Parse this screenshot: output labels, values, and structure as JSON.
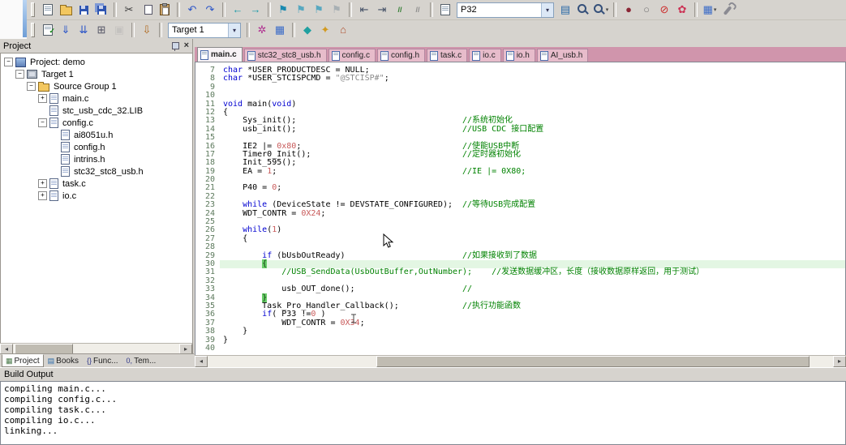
{
  "colors": {
    "keyword": "#0000d0",
    "comment": "#008200",
    "number": "#c85a5a",
    "string": "#8a8a8a",
    "brace_bg": "#6ace6a",
    "row_highlight": "#e3f6e3",
    "tabstrip_bg": "#d095ac",
    "chrome_bg": "#d6d3ce"
  },
  "toolbar1": {
    "items": [
      {
        "name": "new-file-icon",
        "shape": "page"
      },
      {
        "name": "open-file-icon",
        "shape": "folder"
      },
      {
        "name": "save-icon",
        "shape": "floppy"
      },
      {
        "name": "save-all-icon",
        "shape": "floppy-all"
      },
      {
        "sep": true
      },
      {
        "name": "cut-icon",
        "glyph": "✂",
        "color": "#3a3a3a"
      },
      {
        "name": "copy-icon",
        "shape": "copy"
      },
      {
        "name": "paste-icon",
        "shape": "paste"
      },
      {
        "sep": true
      },
      {
        "name": "undo-icon",
        "glyph": "↶",
        "color": "#2b55c8"
      },
      {
        "name": "redo-icon",
        "glyph": "↷",
        "color": "#2b55c8"
      },
      {
        "sep": true
      },
      {
        "name": "navigate-back-icon",
        "glyph": "←",
        "color": "#1a9aa8"
      },
      {
        "name": "navigate-forward-icon",
        "glyph": "→",
        "color": "#1a9aa8"
      },
      {
        "sep": true
      },
      {
        "name": "toggle-bookmark-icon",
        "glyph": "⚑",
        "color": "#1a8ab0"
      },
      {
        "name": "previous-bookmark-icon",
        "glyph": "⚑",
        "color": "#58a8c0"
      },
      {
        "name": "next-bookmark-icon",
        "glyph": "⚑",
        "color": "#58a8c0"
      },
      {
        "name": "clear-bookmarks-icon",
        "glyph": "⚑",
        "color": "#a8b0b4"
      },
      {
        "sep": true
      },
      {
        "name": "indent-left-icon",
        "glyph": "⇤",
        "color": "#445066"
      },
      {
        "name": "indent-right-icon",
        "glyph": "⇥",
        "color": "#445066"
      },
      {
        "name": "comment-icon",
        "glyph": "//",
        "color": "#2a7a2a",
        "small": true
      },
      {
        "name": "uncomment-icon",
        "glyph": "//",
        "color": "#888888",
        "small": true
      },
      {
        "sep": true
      },
      {
        "name": "find-text-icon",
        "shape": "page"
      },
      {
        "type": "combo",
        "name": "find-combobox",
        "text": "P32",
        "width": 118
      },
      {
        "name": "find-in-files-icon",
        "glyph": "▤",
        "color": "#2a6aa8"
      },
      {
        "name": "find-icon",
        "shape": "mag"
      },
      {
        "name": "search-options-icon",
        "shape": "mag",
        "dropdown": true
      },
      {
        "sep": true
      },
      {
        "name": "insert-breakpoint-icon",
        "glyph": "●",
        "color": "#8b2635"
      },
      {
        "name": "enable-disable-breakpoint-icon",
        "glyph": "○",
        "color": "#777777"
      },
      {
        "name": "disable-all-breakpoints-icon",
        "glyph": "⊘",
        "color": "#cc2b2b"
      },
      {
        "name": "kill-all-breakpoints-icon",
        "glyph": "✿",
        "color": "#cc3355"
      },
      {
        "sep": true
      },
      {
        "name": "debug-windows-icon",
        "glyph": "▦",
        "color": "#3a6bc8",
        "dropdown": true
      },
      {
        "name": "configure-tools-icon",
        "shape": "wrench"
      }
    ]
  },
  "toolbar2": {
    "items": [
      {
        "name": "translate-file-icon",
        "shape": "page-check"
      },
      {
        "name": "build-icon",
        "glyph": "⇓",
        "color": "#2b55c8"
      },
      {
        "name": "rebuild-all-icon",
        "glyph": "⇊",
        "color": "#2b55c8"
      },
      {
        "name": "batch-build-icon",
        "glyph": "⊞",
        "color": "#555566"
      },
      {
        "name": "stop-build-icon",
        "glyph": "▣",
        "color": "#aaaaaa",
        "disabled": true
      },
      {
        "sep": true
      },
      {
        "name": "download-icon",
        "glyph": "⇩",
        "color": "#b06a20"
      },
      {
        "sep": true
      },
      {
        "type": "combo",
        "name": "target-combobox",
        "text": "Target 1",
        "width": 88
      },
      {
        "sep": true
      },
      {
        "name": "options-for-target-icon",
        "glyph": "✲",
        "color": "#b03090"
      },
      {
        "name": "manage-project-items-icon",
        "glyph": "▦",
        "color": "#3a6bc8"
      },
      {
        "sep": true
      },
      {
        "name": "diamond-icon",
        "glyph": "◆",
        "color": "#20a0a0"
      },
      {
        "name": "star-icon",
        "glyph": "✦",
        "color": "#d29a20"
      },
      {
        "name": "home-icon",
        "glyph": "⌂",
        "color": "#b05030"
      }
    ]
  },
  "project_panel": {
    "title": "Project",
    "tree": [
      {
        "label": "Project: demo",
        "indent": 0,
        "expander": "minus",
        "icon": "project"
      },
      {
        "label": "Target 1",
        "indent": 1,
        "expander": "minus",
        "icon": "target"
      },
      {
        "label": "Source Group 1",
        "indent": 2,
        "expander": "minus",
        "icon": "folder"
      },
      {
        "label": "main.c",
        "indent": 3,
        "expander": "plus",
        "icon": "page"
      },
      {
        "label": "stc_usb_cdc_32.LIB",
        "indent": 3,
        "expander": "none",
        "icon": "page"
      },
      {
        "label": "config.c",
        "indent": 3,
        "expander": "minus",
        "icon": "page"
      },
      {
        "label": "ai8051u.h",
        "indent": 4,
        "expander": "none",
        "icon": "page"
      },
      {
        "label": "config.h",
        "indent": 4,
        "expander": "none",
        "icon": "page"
      },
      {
        "label": "intrins.h",
        "indent": 4,
        "expander": "none",
        "icon": "page"
      },
      {
        "label": "stc32_stc8_usb.h",
        "indent": 4,
        "expander": "none",
        "icon": "page"
      },
      {
        "label": "task.c",
        "indent": 3,
        "expander": "plus",
        "icon": "page"
      },
      {
        "label": "io.c",
        "indent": 3,
        "expander": "plus",
        "icon": "page"
      }
    ],
    "tabs": [
      {
        "glyph": "▦",
        "color": "#4a7a4a",
        "label": "Project",
        "active": true
      },
      {
        "glyph": "▤",
        "color": "#2a6aa8",
        "label": "Books"
      },
      {
        "glyph": "{}",
        "color": "#333a8a",
        "label": "Func..."
      },
      {
        "glyph": "0,",
        "color": "#333a8a",
        "label": "Tem..."
      }
    ]
  },
  "editor": {
    "tabs": [
      {
        "label": "main.c",
        "active": true
      },
      {
        "label": "stc32_stc8_usb.h"
      },
      {
        "label": "config.c"
      },
      {
        "label": "config.h"
      },
      {
        "label": "task.c"
      },
      {
        "label": "io.c"
      },
      {
        "label": "io.h"
      },
      {
        "label": "AI_usb.h"
      }
    ],
    "lines": [
      {
        "n": 7,
        "c": "char *USER_PRODUCTDESC = NULL;"
      },
      {
        "n": 8,
        "c": "char *USER_STCISPCMD = \"@STCISP#\";"
      },
      {
        "n": 9,
        "c": ""
      },
      {
        "n": 10,
        "c": ""
      },
      {
        "n": 11,
        "c": "void main(void)"
      },
      {
        "n": 12,
        "c": "{"
      },
      {
        "n": 13,
        "c": "    Sys_init();",
        "m": "//系统初始化"
      },
      {
        "n": 14,
        "c": "    usb_init();",
        "m": "//USB CDC 接口配置"
      },
      {
        "n": 15,
        "c": ""
      },
      {
        "n": 16,
        "c": "    IE2 |= 0x80;",
        "m": "//使能USB中断"
      },
      {
        "n": 17,
        "c": "    Timer0_Init();",
        "m": "//定时器初始化"
      },
      {
        "n": 18,
        "c": "    Init_595();"
      },
      {
        "n": 19,
        "c": "    EA = 1;",
        "m": "//IE |= 0X80;"
      },
      {
        "n": 20,
        "c": ""
      },
      {
        "n": 21,
        "c": "    P40 = 0;"
      },
      {
        "n": 22,
        "c": ""
      },
      {
        "n": 23,
        "c": "    while (DeviceState != DEVSTATE_CONFIGURED);",
        "m": "//等待USB完成配置"
      },
      {
        "n": 24,
        "c": "    WDT_CONTR = 0X24;"
      },
      {
        "n": 25,
        "c": ""
      },
      {
        "n": 26,
        "c": "    while(1)"
      },
      {
        "n": 27,
        "c": "    {"
      },
      {
        "n": 28,
        "c": ""
      },
      {
        "n": 29,
        "c": "        if (bUsbOutReady)",
        "m": "//如果接收到了数据"
      },
      {
        "n": 30,
        "c": "        {",
        "hl": true,
        "brace": true
      },
      {
        "n": 31,
        "m": "            //USB_SendData(UsbOutBuffer,OutNumber);    //发送数据缓冲区，长度（接收数据原样返回，用于测试）"
      },
      {
        "n": 32,
        "c": ""
      },
      {
        "n": 33,
        "c": "            usb_OUT_done();",
        "m": "//"
      },
      {
        "n": 34,
        "c": "        }",
        "brace": true
      },
      {
        "n": 35,
        "c": "        Task_Pro_Handler_Callback();",
        "m": "//执行功能函数"
      },
      {
        "n": 36,
        "c": "        if( P33 !=0 )"
      },
      {
        "n": 37,
        "c": "            WDT_CONTR = 0X34;"
      },
      {
        "n": 38,
        "c": "    }"
      },
      {
        "n": 39,
        "c": "}"
      },
      {
        "n": 40,
        "c": ""
      }
    ]
  },
  "build_output": {
    "title": "Build Output",
    "lines": [
      "compiling main.c...",
      "compiling config.c...",
      "compiling task.c...",
      "compiling io.c...",
      "linking..."
    ]
  }
}
